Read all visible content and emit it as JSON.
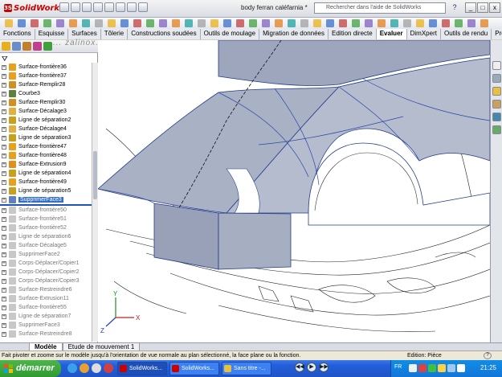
{
  "app": {
    "name": "SolidWorks",
    "document_title": "body ferran caléfarnia *",
    "search_placeholder": "Rechercher dans l'aide de SolidWorks",
    "help": "?"
  },
  "window_controls": [
    "_",
    "□",
    "x"
  ],
  "tabs": [
    {
      "label": "Fonctions"
    },
    {
      "label": "Esquisse"
    },
    {
      "label": "Surfaces"
    },
    {
      "label": "Tôlerie"
    },
    {
      "label": "Constructions soudées"
    },
    {
      "label": "Outils de moulage"
    },
    {
      "label": "Migration de données"
    },
    {
      "label": "Edition directe"
    },
    {
      "label": "Evaluer",
      "active": true
    },
    {
      "label": "DimXpert"
    },
    {
      "label": "Outils de rendu"
    },
    {
      "label": "Prodo"
    }
  ],
  "watermark": "... zalinox. com",
  "feature_tree": {
    "filter_icon": "filter-icon",
    "items": [
      {
        "label": "Surface-frontière36",
        "type": "surface"
      },
      {
        "label": "Surface-frontière37",
        "type": "surface"
      },
      {
        "label": "Surface-Remplir28",
        "type": "fill"
      },
      {
        "label": "Courbe3",
        "type": "curve"
      },
      {
        "label": "Surface-Remplir30",
        "type": "fill"
      },
      {
        "label": "Surface-Décalage3",
        "type": "offset"
      },
      {
        "label": "Ligne de séparation2",
        "type": "split"
      },
      {
        "label": "Surface-Décalage4",
        "type": "offset"
      },
      {
        "label": "Ligne de séparation3",
        "type": "split"
      },
      {
        "label": "Surface-frontière47",
        "type": "surface"
      },
      {
        "label": "Surface-frontière48",
        "type": "surface"
      },
      {
        "label": "Surface-Extrusion9",
        "type": "extrude"
      },
      {
        "label": "Ligne de séparation4",
        "type": "split"
      },
      {
        "label": "Surface-frontière49",
        "type": "surface"
      },
      {
        "label": "Ligne de séparation5",
        "type": "split"
      },
      {
        "label": "SupprimerFace3",
        "type": "delete",
        "selected": true
      },
      {
        "label": "Surface-frontière50",
        "type": "surface",
        "suppressed": true
      },
      {
        "label": "Surface-frontière51",
        "type": "surface",
        "suppressed": true
      },
      {
        "label": "Surface-frontière52",
        "type": "surface",
        "suppressed": true
      },
      {
        "label": "Ligne de séparation6",
        "type": "split",
        "suppressed": true
      },
      {
        "label": "Surface-Décalage5",
        "type": "offset",
        "suppressed": true
      },
      {
        "label": "SupprimerFace2",
        "type": "delete",
        "suppressed": true
      },
      {
        "label": "Corps-Déplacer/Copier1",
        "type": "move",
        "suppressed": true
      },
      {
        "label": "Corps-Déplacer/Copier2",
        "type": "move",
        "suppressed": true
      },
      {
        "label": "Corps-Déplacer/Copier3",
        "type": "move",
        "suppressed": true
      },
      {
        "label": "Surface-Restreindre6",
        "type": "trim",
        "suppressed": true
      },
      {
        "label": "Surface-Extrusion11",
        "type": "extrude",
        "suppressed": true
      },
      {
        "label": "Surface-frontière55",
        "type": "surface",
        "suppressed": true
      },
      {
        "label": "Ligne de séparation7",
        "type": "split",
        "suppressed": true
      },
      {
        "label": "SupprimerFace3",
        "type": "delete",
        "suppressed": true
      },
      {
        "label": "Surface-Restreindre8",
        "type": "trim",
        "suppressed": true
      }
    ]
  },
  "axis_labels": {
    "x": "X",
    "y": "Y",
    "z": "Z"
  },
  "bottom_tabs": [
    {
      "label": "Modèle",
      "active": true
    },
    {
      "label": "Etude de mouvement 1"
    }
  ],
  "status": {
    "message": "Fait pivoter et zoome sur le modèle jusqu'à l'orientation de vue normale au plan sélectionné, la face plane ou la fonction.",
    "mode": "Edition: Pièce",
    "help": "?"
  },
  "taskbar": {
    "start_label": "démarrer",
    "buttons": [
      {
        "label": "SolidWorks...",
        "active": true
      },
      {
        "label": "SolidWorks..."
      },
      {
        "label": "Sans titre -..."
      }
    ],
    "media": [
      "◀◀",
      "▶",
      "▶▶"
    ],
    "language": "FR",
    "clock": "21:25"
  },
  "colors": {
    "model_fill": "#aeb6c8",
    "model_edge": "#243b8c",
    "selection": "#3470c8",
    "taskbar": "#245edb",
    "start": "#2f9a2f"
  }
}
